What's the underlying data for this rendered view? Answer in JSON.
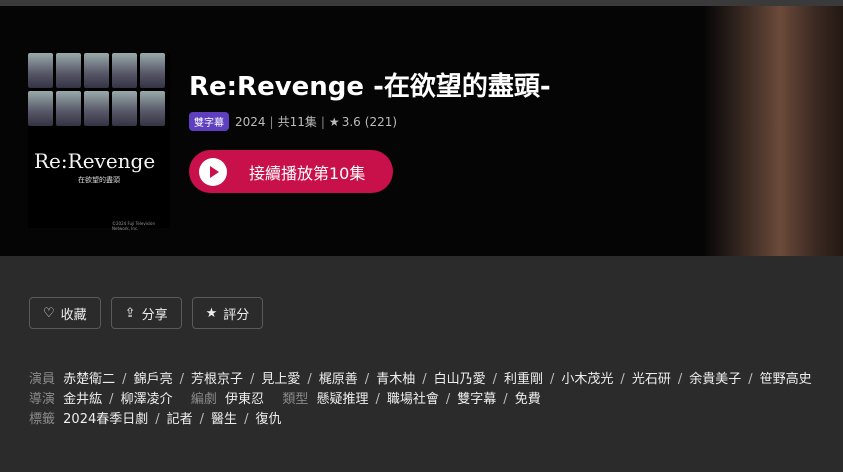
{
  "show": {
    "title": "Re:Revenge -在欲望的盡頭-",
    "badge": "雙字幕",
    "year": "2024",
    "episodes": "共11集",
    "rating": "3.6",
    "rating_count": "(221)",
    "poster_logo": "Re:Revenge",
    "poster_subtitle": "在欲望的盡頭",
    "poster_copyright": "©2024 Fuji Television Network, Inc."
  },
  "play_button": {
    "label": "接續播放第10集"
  },
  "actions": [
    {
      "label": "收藏",
      "icon": "heart-icon"
    },
    {
      "label": "分享",
      "icon": "share-icon"
    },
    {
      "label": "評分",
      "icon": "star-icon"
    }
  ],
  "credits": {
    "cast_label": "演員",
    "cast": [
      "赤楚衛二",
      "錦戶亮",
      "芳根京子",
      "見上愛",
      "梶原善",
      "青木柚",
      "白山乃愛",
      "利重剛",
      "小木茂光",
      "光石研",
      "余貴美子",
      "笹野高史"
    ],
    "director_label": "導演",
    "directors": [
      "金井紘",
      "柳澤凌介"
    ],
    "writer_label": "編劇",
    "writers": [
      "伊東忍"
    ],
    "genre_label": "類型",
    "genres": [
      "懸疑推理",
      "職場社會",
      "雙字幕",
      "免費"
    ],
    "tags_label": "標籤",
    "tags": [
      "2024春季日劇",
      "記者",
      "醫生",
      "復仇"
    ]
  }
}
